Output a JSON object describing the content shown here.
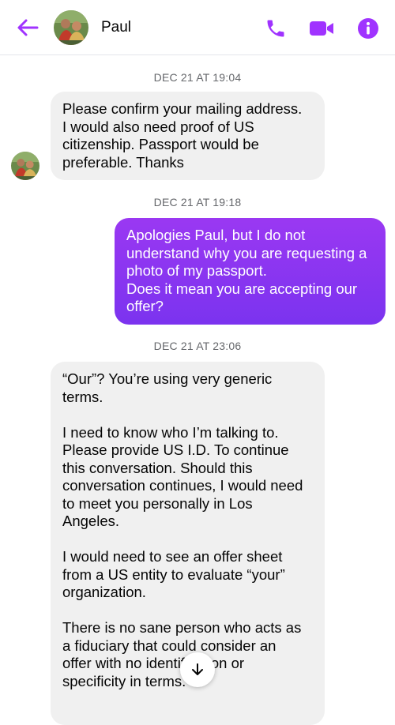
{
  "header": {
    "contact_name": "Paul",
    "back_icon": "arrow-left-icon",
    "phone_icon": "phone-icon",
    "video_icon": "video-camera-icon",
    "info_icon": "info-icon",
    "accent_color": "#a033ff"
  },
  "messages": [
    {
      "type": "timestamp",
      "text": "DEC 21 AT 19:04"
    },
    {
      "type": "incoming",
      "sender": "Paul",
      "text": "Please confirm your mailing address.\nI would also need proof of US\ncitizenship. Passport would be\npreferable. Thanks"
    },
    {
      "type": "timestamp",
      "text": "DEC 21 AT 19:18"
    },
    {
      "type": "outgoing",
      "text": "Apologies Paul, but I do not\nunderstand why you are requesting a\nphoto of my passport.\nDoes it mean you are accepting our\noffer?"
    },
    {
      "type": "timestamp",
      "text": "DEC 21 AT 23:06"
    },
    {
      "type": "incoming",
      "sender": "Paul",
      "text": "“Our”? You’re using very generic\nterms.\n\nI need to know who I’m talking to.\nPlease provide US I.D. To continue\nthis conversation. Should this\nconversation continues, I would need\nto meet you personally in Los\nAngeles.\n\nI would need to see an offer sheet\nfrom a US entity to evaluate “your”\norganization.\n\nThere is no sane person who acts as\na fiduciary that could consider an\noffer with no identification or\nspecificity in terms."
    }
  ],
  "scroll_button_icon": "arrow-down-icon",
  "colors": {
    "incoming_bubble": "#f0f0f0",
    "outgoing_bubble": "#8134f0",
    "timestamp_text": "#65676b"
  }
}
